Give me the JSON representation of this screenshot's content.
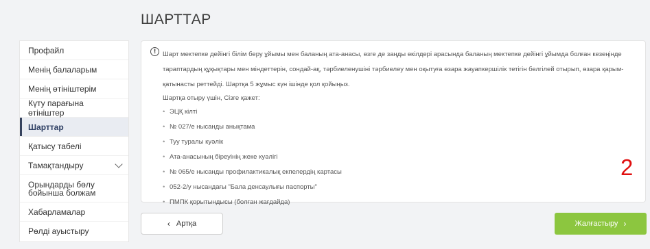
{
  "page": {
    "title": "ШАРТТАР"
  },
  "sidebar": {
    "items": [
      {
        "label": "Профайл"
      },
      {
        "label": "Менің балаларым"
      },
      {
        "label": "Менің өтініштерім"
      },
      {
        "label": "Күту парағына өтініштер"
      },
      {
        "label": "Шарттар",
        "active": true
      },
      {
        "label": "Қатысу табелі"
      },
      {
        "label": "Тамақтандыру",
        "expandable": true
      },
      {
        "label_line1": "Орындарды бөлу",
        "label_line2": "бойынша болжам"
      },
      {
        "label": "Хабарламалар"
      },
      {
        "label": "Рөлді ауыстыру"
      }
    ]
  },
  "info": {
    "icon": "info-icon",
    "icon_glyph": "!",
    "paragraph_line1": "Шарт мектепке дейінгі білім беру ұйымы мен баланың ата-анасы, өзге де заңды өкілдері арасында баланың мектепке дейінгі ұйымда болған кезеңінде",
    "paragraph_line2": "тараптардың құқықтары мен міндеттерін, сондай-ақ, тәрбиеленушіні тәрбиелеу мен оқытуға өзара жауапкершілік тетігін белгілей отырып, өзара қарым-",
    "paragraph_line3": "қатынасты реттейді. Шартқа 5 жұмыс күн ішінде қол қойыңыз.",
    "list_intro": "Шартқа отыру үшін, Сізге қажет:",
    "bullet": "•",
    "requirements": [
      "ЭЦҚ кілті",
      "№ 027/е нысанды анықтама",
      "Туу туралы куәлік",
      "Ата-анасының біреуінің жеке куәлігі",
      "№ 065/е нысанды профилактикалық екпелердің картасы",
      "052-2/у нысандағы \"Бала денсаулығы паспорты\"",
      "ПМПК қорытындысы (болған жағдайда)"
    ]
  },
  "buttons": {
    "back_label": "Артқа",
    "back_arrow": "‹",
    "next_label": "Жалғастыру",
    "next_arrow": "›",
    "next_color": "#8cc63f"
  },
  "annotation": {
    "number": "2",
    "color": "#e01010"
  }
}
